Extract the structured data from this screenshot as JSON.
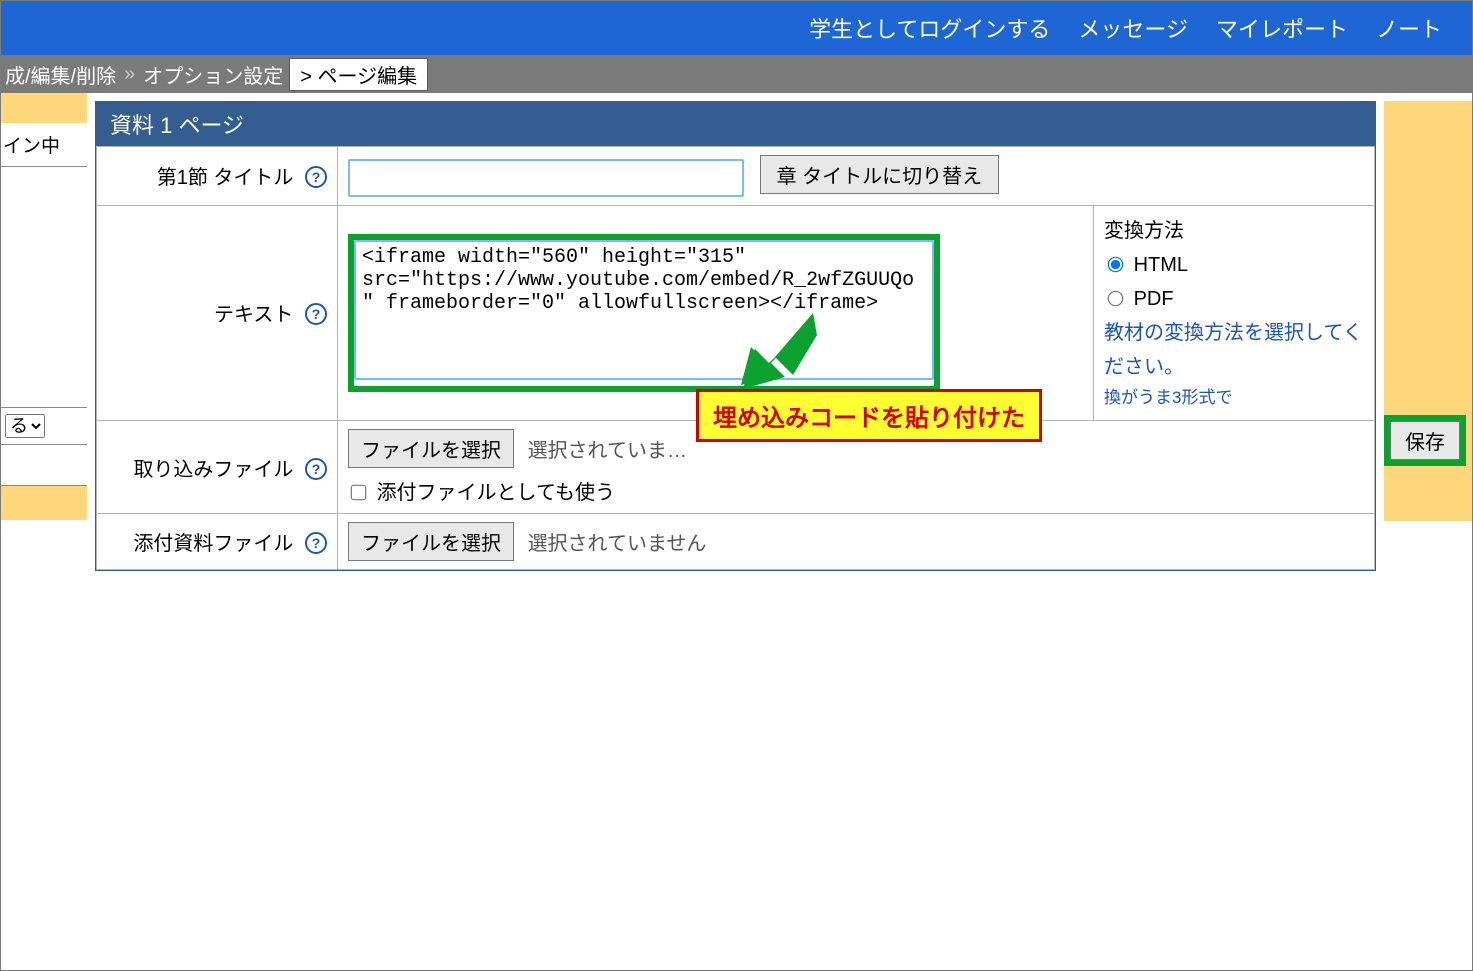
{
  "topnav": {
    "login_as_student": "学生としてログインする",
    "messages": "メッセージ",
    "my_report": "マイレポート",
    "notes": "ノート"
  },
  "breadcrumb": {
    "b1": "成/編集/削除",
    "b2": "オプション設定",
    "active": "> ページ編集",
    "sep": "»"
  },
  "sidebar": {
    "logged_in": "イン中",
    "dropdown": "る"
  },
  "form": {
    "title": "資料 1 ページ",
    "section_title_label": "第1節 タイトル",
    "section_title_value": "",
    "switch_chapter": "章 タイトルに切り替え",
    "text_label": "テキスト",
    "text_value": "<iframe width=\"560\" height=\"315\" src=\"https://www.youtube.com/embed/R_2wfZGUUQo\" frameborder=\"0\" allowfullscreen></iframe>",
    "conv": {
      "heading": "変換方法",
      "html": "HTML",
      "pdf": "PDF",
      "hint": "教材の変換方法を選択してください。",
      "note": "換がうま3形式で"
    },
    "import_label": "取り込みファイル",
    "file_btn": "ファイルを選択",
    "no_file": "選択されていません",
    "no_file_short": "選択されていま…",
    "attach_use": "添付ファイルとしても使う",
    "attach_label": "添付資料ファイル",
    "save": "保存"
  },
  "callout": "埋め込みコードを貼り付けた"
}
